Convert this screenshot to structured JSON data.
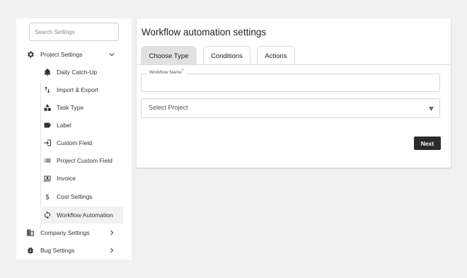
{
  "sidebar": {
    "search": {
      "placeholder": "Search Settings"
    },
    "groups": [
      {
        "label": "Project Settings",
        "icon": "gear-icon",
        "arrow": "chevron-down-icon"
      },
      {
        "label": "Company Settings",
        "icon": "building-icon",
        "arrow": "chevron-right-icon"
      },
      {
        "label": "Bug Settings",
        "icon": "bug-icon",
        "arrow": "chevron-right-icon"
      }
    ],
    "items": [
      {
        "label": "Daily Catch-Up",
        "icon": "bell-icon"
      },
      {
        "label": "Import & Export",
        "icon": "import-export-icon"
      },
      {
        "label": "Task Type",
        "icon": "shapes-icon"
      },
      {
        "label": "Label",
        "icon": "label-icon"
      },
      {
        "label": "Custom Field",
        "icon": "login-icon"
      },
      {
        "label": "Project Custom Field",
        "icon": "list-icon"
      },
      {
        "label": "Invoice",
        "icon": "invoice-icon"
      },
      {
        "label": "Cost Settings",
        "icon": "dollar-icon"
      },
      {
        "label": "Workflow Automation",
        "icon": "sync-icon",
        "active": true
      }
    ]
  },
  "main": {
    "title": "Workflow automation settings",
    "tabs": [
      {
        "label": "Choose Type",
        "active": true
      },
      {
        "label": "Conditions"
      },
      {
        "label": "Actions"
      }
    ],
    "workflow_name": {
      "label": "Workflow Name",
      "required_mark": "*",
      "value": ""
    },
    "project_select": {
      "value": "Select Project"
    },
    "next_label": "Next"
  },
  "colors": {
    "accent_dark": "#2b2b2b",
    "active_tab_bg": "#e1e1e1",
    "required": "#d32f2f",
    "page_bg": "#f1f1f1"
  }
}
